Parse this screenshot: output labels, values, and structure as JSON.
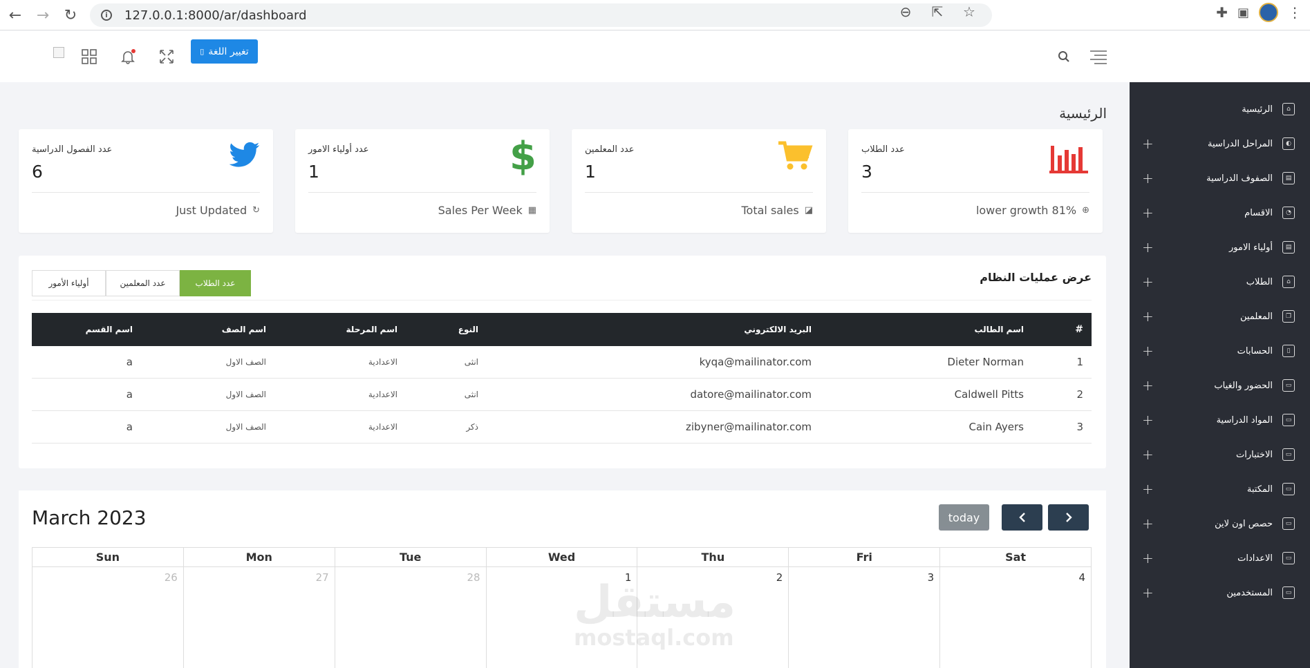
{
  "browser": {
    "url": "127.0.0.1:8000/ar/dashboard"
  },
  "header": {
    "lang_button": "تغيير اللغة"
  },
  "page_title": "الرئيسية",
  "sidebar": {
    "items": [
      {
        "label": "الرئيسية",
        "expandable": false,
        "icon": "home-icon"
      },
      {
        "label": "المراحل الدراسية",
        "expandable": true,
        "icon": "palette-icon"
      },
      {
        "label": "الصفوف الدراسية",
        "expandable": true,
        "icon": "calendar-icon"
      },
      {
        "label": "الاقسام",
        "expandable": true,
        "icon": "pie-chart-icon"
      },
      {
        "label": "أولياء الامور",
        "expandable": true,
        "icon": "calendar-icon"
      },
      {
        "label": "الطلاب",
        "expandable": true,
        "icon": "home-icon"
      },
      {
        "label": "المعلمين",
        "expandable": true,
        "icon": "copy-icon"
      },
      {
        "label": "الحسابات",
        "expandable": true,
        "icon": "file-icon"
      },
      {
        "label": "الحضور والغياب",
        "expandable": true,
        "icon": "id-card-icon"
      },
      {
        "label": "المواد الدراسية",
        "expandable": true,
        "icon": "id-card-icon"
      },
      {
        "label": "الاختبارات",
        "expandable": true,
        "icon": "id-card-icon"
      },
      {
        "label": "المكتبة",
        "expandable": true,
        "icon": "id-card-icon"
      },
      {
        "label": "حصص اون لاين",
        "expandable": true,
        "icon": "id-card-icon"
      },
      {
        "label": "الاعدادات",
        "expandable": true,
        "icon": "id-card-icon"
      },
      {
        "label": "المستخدمين",
        "expandable": true,
        "icon": "id-card-icon"
      }
    ]
  },
  "stats": [
    {
      "label": "عدد الطلاب",
      "value": "3",
      "footer": "lower growth 81%",
      "icon": "bar-chart-icon",
      "color": "#e53935"
    },
    {
      "label": "عدد المعلمين",
      "value": "1",
      "footer": "Total sales",
      "icon": "cart-icon",
      "color": "#fbc02d"
    },
    {
      "label": "عدد أولياء الامور",
      "value": "1",
      "footer": "Sales Per Week",
      "icon": "dollar-icon",
      "color": "#43a047"
    },
    {
      "label": "عدد الفصول الدراسية",
      "value": "6",
      "footer": "Just Updated",
      "icon": "twitter-icon",
      "color": "#1e88e5"
    }
  ],
  "operations": {
    "title": "عرض عمليات النظام",
    "tabs": [
      "عدد الطلاب",
      "عدد المعلمين",
      "أولياء الأمور"
    ],
    "active_tab": "عدد الطلاب",
    "columns": [
      "#",
      "اسم الطالب",
      "البريد الالكتروني",
      "النوع",
      "اسم المرحلة",
      "اسم الصف",
      "اسم القسم"
    ],
    "rows": [
      [
        "1",
        "Dieter Norman",
        "kyqa@mailinator.com",
        "انثى",
        "الاعدادية",
        "الصف الاول",
        "a"
      ],
      [
        "2",
        "Caldwell Pitts",
        "datore@mailinator.com",
        "انثى",
        "الاعدادية",
        "الصف الاول",
        "a"
      ],
      [
        "3",
        "Cain Ayers",
        "zibyner@mailinator.com",
        "ذكر",
        "الاعدادية",
        "الصف الاول",
        "a"
      ]
    ]
  },
  "calendar": {
    "title": "March 2023",
    "today_label": "today",
    "days": [
      "Sun",
      "Mon",
      "Tue",
      "Wed",
      "Thu",
      "Fri",
      "Sat"
    ],
    "first_week": [
      "26",
      "27",
      "28",
      "1",
      "2",
      "3",
      "4"
    ]
  },
  "watermark": {
    "arabic": "مستقل",
    "latin": "mostaql.com"
  }
}
